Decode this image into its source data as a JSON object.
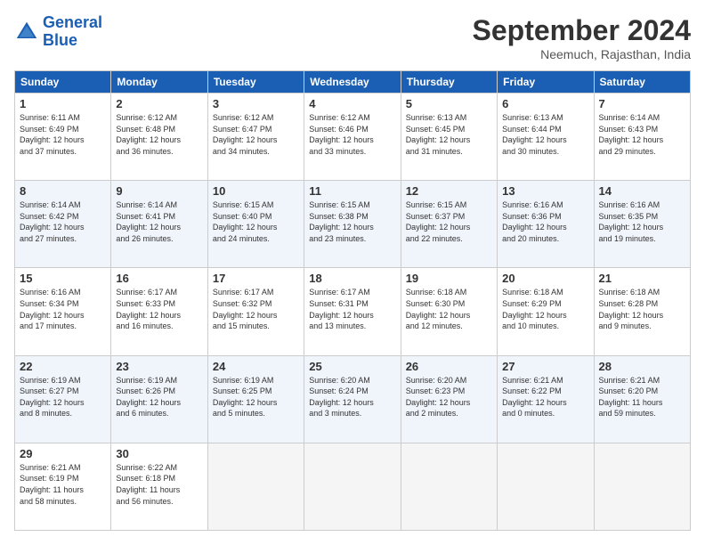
{
  "logo": {
    "line1": "General",
    "line2": "Blue"
  },
  "title": "September 2024",
  "subtitle": "Neemuch, Rajasthan, India",
  "days_header": [
    "Sunday",
    "Monday",
    "Tuesday",
    "Wednesday",
    "Thursday",
    "Friday",
    "Saturday"
  ],
  "weeks": [
    [
      {
        "num": "1",
        "info": "Sunrise: 6:11 AM\nSunset: 6:49 PM\nDaylight: 12 hours\nand 37 minutes."
      },
      {
        "num": "2",
        "info": "Sunrise: 6:12 AM\nSunset: 6:48 PM\nDaylight: 12 hours\nand 36 minutes."
      },
      {
        "num": "3",
        "info": "Sunrise: 6:12 AM\nSunset: 6:47 PM\nDaylight: 12 hours\nand 34 minutes."
      },
      {
        "num": "4",
        "info": "Sunrise: 6:12 AM\nSunset: 6:46 PM\nDaylight: 12 hours\nand 33 minutes."
      },
      {
        "num": "5",
        "info": "Sunrise: 6:13 AM\nSunset: 6:45 PM\nDaylight: 12 hours\nand 31 minutes."
      },
      {
        "num": "6",
        "info": "Sunrise: 6:13 AM\nSunset: 6:44 PM\nDaylight: 12 hours\nand 30 minutes."
      },
      {
        "num": "7",
        "info": "Sunrise: 6:14 AM\nSunset: 6:43 PM\nDaylight: 12 hours\nand 29 minutes."
      }
    ],
    [
      {
        "num": "8",
        "info": "Sunrise: 6:14 AM\nSunset: 6:42 PM\nDaylight: 12 hours\nand 27 minutes."
      },
      {
        "num": "9",
        "info": "Sunrise: 6:14 AM\nSunset: 6:41 PM\nDaylight: 12 hours\nand 26 minutes."
      },
      {
        "num": "10",
        "info": "Sunrise: 6:15 AM\nSunset: 6:40 PM\nDaylight: 12 hours\nand 24 minutes."
      },
      {
        "num": "11",
        "info": "Sunrise: 6:15 AM\nSunset: 6:38 PM\nDaylight: 12 hours\nand 23 minutes."
      },
      {
        "num": "12",
        "info": "Sunrise: 6:15 AM\nSunset: 6:37 PM\nDaylight: 12 hours\nand 22 minutes."
      },
      {
        "num": "13",
        "info": "Sunrise: 6:16 AM\nSunset: 6:36 PM\nDaylight: 12 hours\nand 20 minutes."
      },
      {
        "num": "14",
        "info": "Sunrise: 6:16 AM\nSunset: 6:35 PM\nDaylight: 12 hours\nand 19 minutes."
      }
    ],
    [
      {
        "num": "15",
        "info": "Sunrise: 6:16 AM\nSunset: 6:34 PM\nDaylight: 12 hours\nand 17 minutes."
      },
      {
        "num": "16",
        "info": "Sunrise: 6:17 AM\nSunset: 6:33 PM\nDaylight: 12 hours\nand 16 minutes."
      },
      {
        "num": "17",
        "info": "Sunrise: 6:17 AM\nSunset: 6:32 PM\nDaylight: 12 hours\nand 15 minutes."
      },
      {
        "num": "18",
        "info": "Sunrise: 6:17 AM\nSunset: 6:31 PM\nDaylight: 12 hours\nand 13 minutes."
      },
      {
        "num": "19",
        "info": "Sunrise: 6:18 AM\nSunset: 6:30 PM\nDaylight: 12 hours\nand 12 minutes."
      },
      {
        "num": "20",
        "info": "Sunrise: 6:18 AM\nSunset: 6:29 PM\nDaylight: 12 hours\nand 10 minutes."
      },
      {
        "num": "21",
        "info": "Sunrise: 6:18 AM\nSunset: 6:28 PM\nDaylight: 12 hours\nand 9 minutes."
      }
    ],
    [
      {
        "num": "22",
        "info": "Sunrise: 6:19 AM\nSunset: 6:27 PM\nDaylight: 12 hours\nand 8 minutes."
      },
      {
        "num": "23",
        "info": "Sunrise: 6:19 AM\nSunset: 6:26 PM\nDaylight: 12 hours\nand 6 minutes."
      },
      {
        "num": "24",
        "info": "Sunrise: 6:19 AM\nSunset: 6:25 PM\nDaylight: 12 hours\nand 5 minutes."
      },
      {
        "num": "25",
        "info": "Sunrise: 6:20 AM\nSunset: 6:24 PM\nDaylight: 12 hours\nand 3 minutes."
      },
      {
        "num": "26",
        "info": "Sunrise: 6:20 AM\nSunset: 6:23 PM\nDaylight: 12 hours\nand 2 minutes."
      },
      {
        "num": "27",
        "info": "Sunrise: 6:21 AM\nSunset: 6:22 PM\nDaylight: 12 hours\nand 0 minutes."
      },
      {
        "num": "28",
        "info": "Sunrise: 6:21 AM\nSunset: 6:20 PM\nDaylight: 11 hours\nand 59 minutes."
      }
    ],
    [
      {
        "num": "29",
        "info": "Sunrise: 6:21 AM\nSunset: 6:19 PM\nDaylight: 11 hours\nand 58 minutes."
      },
      {
        "num": "30",
        "info": "Sunrise: 6:22 AM\nSunset: 6:18 PM\nDaylight: 11 hours\nand 56 minutes."
      },
      {
        "num": "",
        "info": ""
      },
      {
        "num": "",
        "info": ""
      },
      {
        "num": "",
        "info": ""
      },
      {
        "num": "",
        "info": ""
      },
      {
        "num": "",
        "info": ""
      }
    ]
  ]
}
